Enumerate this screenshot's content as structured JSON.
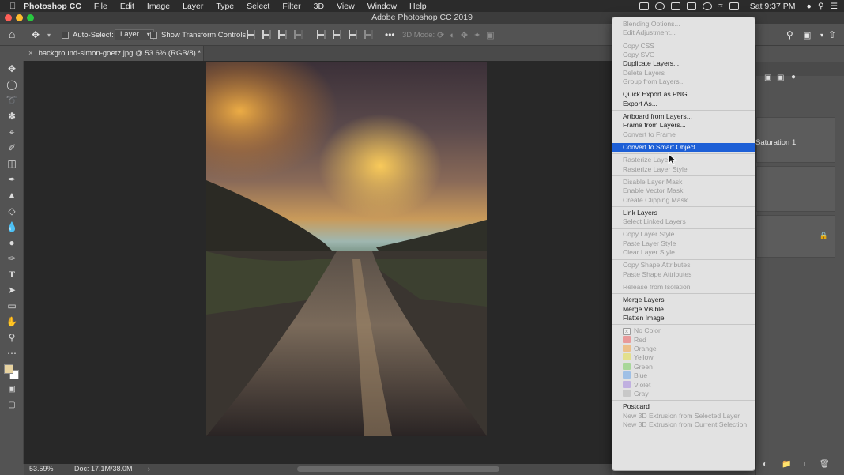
{
  "menubar": {
    "app_name": "Photoshop CC",
    "items": [
      "File",
      "Edit",
      "Image",
      "Layer",
      "Type",
      "Select",
      "Filter",
      "3D",
      "View",
      "Window",
      "Help"
    ],
    "clock": "Sat 9:37 PM"
  },
  "window": {
    "title": "Adobe Photoshop CC 2019"
  },
  "options_bar": {
    "auto_select_label": "Auto-Select:",
    "auto_select_value": "Layer",
    "transform_label": "Show Transform Controls",
    "mode_3d_label": "3D Mode:"
  },
  "document_tab": {
    "title": "background-simon-goetz.jpg @ 53.6% (RGB/8) *",
    "close_glyph": "×"
  },
  "status_bar": {
    "zoom": "53.59%",
    "doc": "Doc: 17.1M/38.0M",
    "arrow": "›"
  },
  "right_panel": {
    "layer_name": "Saturation 1"
  },
  "context_menu": {
    "sections": [
      [
        {
          "label": "Blending Options...",
          "enabled": false
        },
        {
          "label": "Edit Adjustment...",
          "enabled": false
        }
      ],
      [
        {
          "label": "Copy CSS",
          "enabled": false
        },
        {
          "label": "Copy SVG",
          "enabled": false
        },
        {
          "label": "Duplicate Layers...",
          "enabled": true
        },
        {
          "label": "Delete Layers",
          "enabled": false
        },
        {
          "label": "Group from Layers...",
          "enabled": false
        }
      ],
      [
        {
          "label": "Quick Export as PNG",
          "enabled": true
        },
        {
          "label": "Export As...",
          "enabled": true
        }
      ],
      [
        {
          "label": "Artboard from Layers...",
          "enabled": true
        },
        {
          "label": "Frame from Layers...",
          "enabled": true
        },
        {
          "label": "Convert to Frame",
          "enabled": false
        }
      ],
      [
        {
          "label": "Convert to Smart Object",
          "enabled": true,
          "highlighted": true
        }
      ],
      [
        {
          "label": "Rasterize Layers",
          "enabled": false
        },
        {
          "label": "Rasterize Layer Style",
          "enabled": false
        }
      ],
      [
        {
          "label": "Disable Layer Mask",
          "enabled": false
        },
        {
          "label": "Enable Vector Mask",
          "enabled": false
        },
        {
          "label": "Create Clipping Mask",
          "enabled": false
        }
      ],
      [
        {
          "label": "Link Layers",
          "enabled": true
        },
        {
          "label": "Select Linked Layers",
          "enabled": false
        }
      ],
      [
        {
          "label": "Copy Layer Style",
          "enabled": false
        },
        {
          "label": "Paste Layer Style",
          "enabled": false
        },
        {
          "label": "Clear Layer Style",
          "enabled": false
        }
      ],
      [
        {
          "label": "Copy Shape Attributes",
          "enabled": false
        },
        {
          "label": "Paste Shape Attributes",
          "enabled": false
        }
      ],
      [
        {
          "label": "Release from Isolation",
          "enabled": false
        }
      ],
      [
        {
          "label": "Merge Layers",
          "enabled": true
        },
        {
          "label": "Merge Visible",
          "enabled": true
        },
        {
          "label": "Flatten Image",
          "enabled": true
        }
      ],
      [
        {
          "label": "No Color",
          "enabled": false,
          "color": "none"
        },
        {
          "label": "Red",
          "enabled": false,
          "color": "#e89a9a"
        },
        {
          "label": "Orange",
          "enabled": false,
          "color": "#ecc08a"
        },
        {
          "label": "Yellow",
          "enabled": false,
          "color": "#e3e08c"
        },
        {
          "label": "Green",
          "enabled": false,
          "color": "#a8d79a"
        },
        {
          "label": "Blue",
          "enabled": false,
          "color": "#9fc0e6"
        },
        {
          "label": "Violet",
          "enabled": false,
          "color": "#c0b0e0"
        },
        {
          "label": "Gray",
          "enabled": false,
          "color": "#c8c8c8"
        }
      ],
      [
        {
          "label": "Postcard",
          "enabled": true
        },
        {
          "label": "New 3D Extrusion from Selected Layer",
          "enabled": false
        },
        {
          "label": "New 3D Extrusion from Current Selection",
          "enabled": false
        }
      ]
    ]
  },
  "colors": {
    "highlight": "#1d5fd6",
    "foreground_swatch": "#e8d3a0",
    "background_swatch": "#ffffff"
  }
}
